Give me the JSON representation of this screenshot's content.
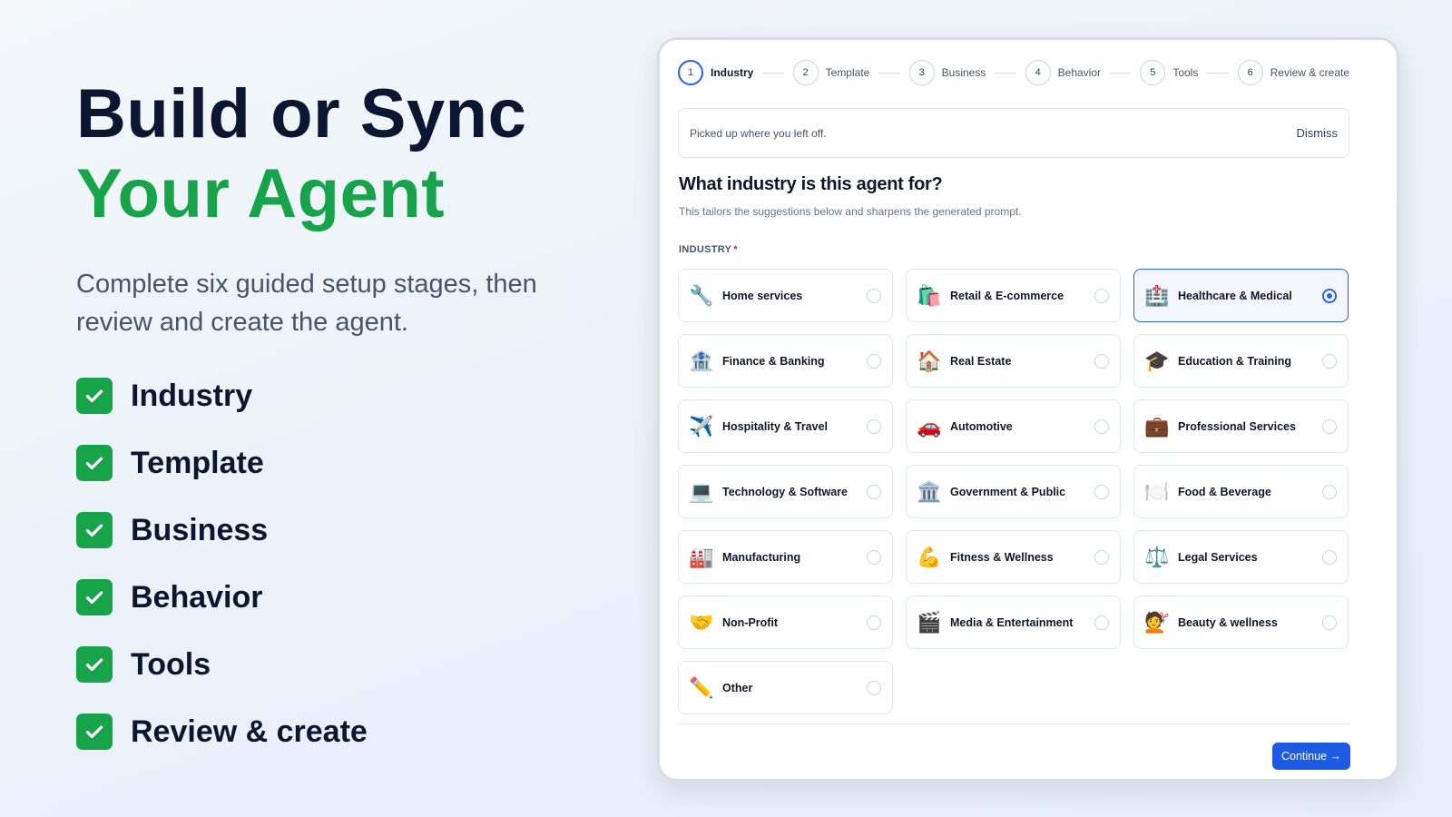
{
  "hero": {
    "line1": "Build or Sync",
    "line2": "Your Agent",
    "subtitle": "Complete six guided setup stages, then review and create the agent.",
    "accent_color": "#16a34a"
  },
  "checklist": [
    {
      "label": "Industry"
    },
    {
      "label": "Template"
    },
    {
      "label": "Business"
    },
    {
      "label": "Behavior"
    },
    {
      "label": "Tools"
    },
    {
      "label": "Review & create"
    }
  ],
  "stepper": [
    {
      "num": "1",
      "label": "Industry",
      "active": true
    },
    {
      "num": "2",
      "label": "Template"
    },
    {
      "num": "3",
      "label": "Business"
    },
    {
      "num": "4",
      "label": "Behavior"
    },
    {
      "num": "5",
      "label": "Tools"
    },
    {
      "num": "6",
      "label": "Review & create"
    }
  ],
  "banner": {
    "text": "Picked up where you left off.",
    "dismiss_label": "Dismiss"
  },
  "question": {
    "title": "What industry is this agent for?",
    "subtitle": "This tailors the suggestions below and sharpens the generated prompt.",
    "field_label": "INDUSTRY",
    "required_mark": "*"
  },
  "industries": [
    {
      "label": "Home services",
      "icon": "wrench-icon",
      "glyph": "🔧"
    },
    {
      "label": "Retail & E-commerce",
      "icon": "shopping-bags-icon",
      "glyph": "🛍️"
    },
    {
      "label": "Healthcare & Medical",
      "icon": "hospital-icon",
      "glyph": "🏥",
      "selected": true
    },
    {
      "label": "Finance & Banking",
      "icon": "bank-icon",
      "glyph": "🏦"
    },
    {
      "label": "Real Estate",
      "icon": "house-icon",
      "glyph": "🏠"
    },
    {
      "label": "Education & Training",
      "icon": "graduation-cap-icon",
      "glyph": "🎓"
    },
    {
      "label": "Hospitality & Travel",
      "icon": "airplane-icon",
      "glyph": "✈️"
    },
    {
      "label": "Automotive",
      "icon": "car-icon",
      "glyph": "🚗"
    },
    {
      "label": "Professional Services",
      "icon": "briefcase-icon",
      "glyph": "💼"
    },
    {
      "label": "Technology & Software",
      "icon": "laptop-icon",
      "glyph": "💻"
    },
    {
      "label": "Government & Public",
      "icon": "classical-building-icon",
      "glyph": "🏛️"
    },
    {
      "label": "Food & Beverage",
      "icon": "plate-icon",
      "glyph": "🍽️"
    },
    {
      "label": "Manufacturing",
      "icon": "factory-icon",
      "glyph": "🏭"
    },
    {
      "label": "Fitness & Wellness",
      "icon": "flexed-bicep-icon",
      "glyph": "💪"
    },
    {
      "label": "Legal Services",
      "icon": "scales-icon",
      "glyph": "⚖️"
    },
    {
      "label": "Non-Profit",
      "icon": "handshake-icon",
      "glyph": "🤝"
    },
    {
      "label": "Media & Entertainment",
      "icon": "clapper-board-icon",
      "glyph": "🎬"
    },
    {
      "label": "Beauty & wellness",
      "icon": "hairdresser-icon",
      "glyph": "💇"
    },
    {
      "label": "Other",
      "icon": "pencil-icon",
      "glyph": "✏️"
    }
  ],
  "footer": {
    "continue_label": "Continue →",
    "button_color": "#1d5be4"
  }
}
